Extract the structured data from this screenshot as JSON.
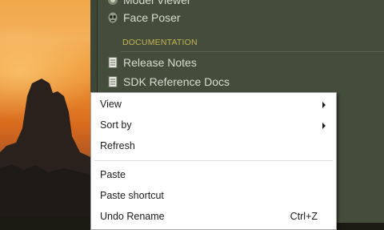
{
  "sdk_panel": {
    "items_top": [
      {
        "label": "Model Viewer",
        "icon": "model-viewer-icon"
      },
      {
        "label": "Face Poser",
        "icon": "face-poser-icon"
      }
    ],
    "section_title": "DOCUMENTATION",
    "doc_items": [
      {
        "label": "Release Notes",
        "icon": "document-icon"
      },
      {
        "label": "SDK Reference Docs",
        "icon": "document-icon"
      }
    ]
  },
  "context_menu": {
    "items": [
      {
        "label": "View",
        "submenu": true
      },
      {
        "label": "Sort by",
        "submenu": true
      },
      {
        "label": "Refresh",
        "submenu": false
      },
      {
        "label": "Paste",
        "submenu": false
      },
      {
        "label": "Paste shortcut",
        "submenu": false
      },
      {
        "label": "Undo Rename",
        "shortcut": "Ctrl+Z"
      }
    ]
  },
  "colors": {
    "panel_bg": "#444c3c",
    "section_title": "#c4b550",
    "panel_text": "#d9ddd0",
    "menu_bg": "#ffffff"
  }
}
